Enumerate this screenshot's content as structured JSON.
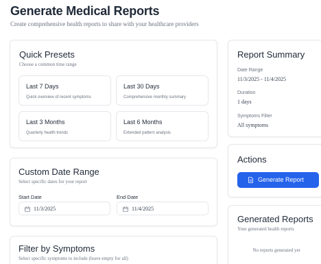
{
  "header": {
    "title": "Generate Medical Reports",
    "subtitle": "Create comprehensive health reports to share with your healthcare providers"
  },
  "presets": {
    "title": "Quick Presets",
    "subtitle": "Choose a common time range",
    "items": [
      {
        "label": "Last 7 Days",
        "description": "Quick overview of recent symptoms"
      },
      {
        "label": "Last 30 Days",
        "description": "Comprehensive monthly summary"
      },
      {
        "label": "Last 3 Months",
        "description": "Quarterly health trends"
      },
      {
        "label": "Last 6 Months",
        "description": "Extended pattern analysis"
      }
    ]
  },
  "custom_range": {
    "title": "Custom Date Range",
    "subtitle": "Select specific dates for your report",
    "start_label": "Start Date",
    "start_value": "11/3/2025",
    "end_label": "End Date",
    "end_value": "11/4/2025"
  },
  "filter": {
    "title": "Filter by Symptoms",
    "subtitle": "Select specific symptoms to include (leave empty for all)"
  },
  "summary": {
    "title": "Report Summary",
    "date_range_label": "Date Range",
    "date_range_value": "11/3/2025 - 11/4/2025",
    "duration_label": "Duration",
    "duration_value": "1 days",
    "symptoms_label": "Symptoms Filter",
    "symptoms_value": "All symptoms"
  },
  "actions": {
    "title": "Actions",
    "generate_label": "Generate Report"
  },
  "generated": {
    "title": "Generated Reports",
    "subtitle": "Your generated health reports",
    "empty_text": "No reports generated yet"
  },
  "colors": {
    "primary": "#2563eb",
    "border": "#e5e7eb",
    "text": "#1f2937",
    "muted": "#6b7280"
  },
  "icons": {
    "calendar": "calendar-icon",
    "document": "document-icon"
  }
}
